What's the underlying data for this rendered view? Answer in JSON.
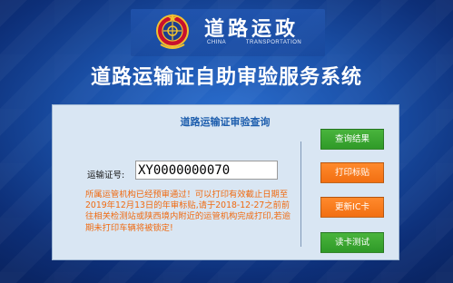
{
  "header": {
    "brand_cn": "道路运政",
    "brand_en": "CHINA TRANSPORTATION",
    "system_title": "道路运输证自助审验服务系统",
    "emblem_icon": "transport-emblem-icon"
  },
  "panel": {
    "title": "道路运输证审验查询",
    "field_label": "运输证号:",
    "field_value": "XY0000000070",
    "notice": "所属运管机构已经预审通过！可以打印有效截止日期至2019年12月13日的年审标贴,请于2018-12-27之前前往相关检测站或陕西境内附近的运管机构完成打印,若逾期未打印车辆将被锁定!"
  },
  "buttons": {
    "query_result": "查询结果",
    "print_label": "打印标贴",
    "update_ic_card": "更新IC卡",
    "read_card_test": "读卡测试"
  },
  "colors": {
    "background": "#1a4fa6",
    "panel": "#d9e6f3",
    "panel_title": "#1f5fae",
    "notice": "#f06a10",
    "green_button": "#3aa530",
    "orange_button": "#f47a1d"
  }
}
